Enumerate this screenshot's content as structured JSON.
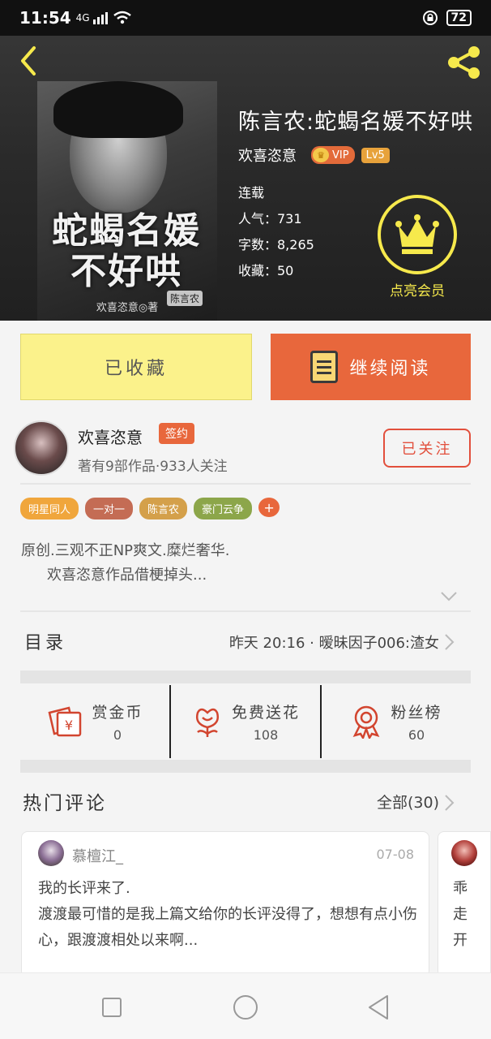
{
  "status_bar": {
    "time": "11:54",
    "signal": "4G",
    "battery": "72"
  },
  "book": {
    "title": "陈言农:蛇蝎名媛不好哄",
    "author": "欢喜恣意",
    "vip_label": "VIP",
    "level": "Lv5",
    "status": "连载",
    "popularity": "人气：731",
    "word_count": "字数：8,265",
    "favorites": "收藏：50",
    "member_label": "点亮会员"
  },
  "cover": {
    "title": "蛇蝎名媛不好哄",
    "seal": "陈言农",
    "author_line": "欢喜恣意◎著"
  },
  "actions": {
    "favorited_label": "已收藏",
    "continue_label": "继续阅读"
  },
  "author_card": {
    "name": "欢喜恣意",
    "sign_badge": "签约",
    "info": "著有9部作品·933人关注",
    "follow_label": "已关注"
  },
  "tags": [
    {
      "label": "明星同人",
      "color": "#f0a63c"
    },
    {
      "label": "一对一",
      "color": "#c46c54"
    },
    {
      "label": "陈言农",
      "color": "#d4a04a"
    },
    {
      "label": "豪门云争",
      "color": "#8ca64a"
    }
  ],
  "tag_more": "+",
  "intro": {
    "line1": "原创.三观不正NP爽文.糜烂奢华.",
    "line2": "欢喜恣意作品借梗掉头..."
  },
  "toc": {
    "title": "目录",
    "latest": "昨天 20:16 · 暧昧因子006:渣女"
  },
  "stats": [
    {
      "label": "赏金币",
      "value": "0",
      "icon": "coin-envelope-icon"
    },
    {
      "label": "免费送花",
      "value": "108",
      "icon": "flower-icon"
    },
    {
      "label": "粉丝榜",
      "value": "60",
      "icon": "medal-icon"
    }
  ],
  "comments": {
    "title": "热门评论",
    "all_label": "全部(30)",
    "items": [
      {
        "user": "慕檀江_",
        "date": "07-08",
        "text": "我的长评来了.\n渡渡最可惜的是我上篇文给你的长评没得了，想想有点小伤心，跟渡渡相处以来啊..."
      },
      {
        "text": "乖走开"
      }
    ]
  },
  "colors": {
    "accent": "#e8673c",
    "favorite_bg": "#fbf28b",
    "member_yellow": "#f6e94c"
  }
}
